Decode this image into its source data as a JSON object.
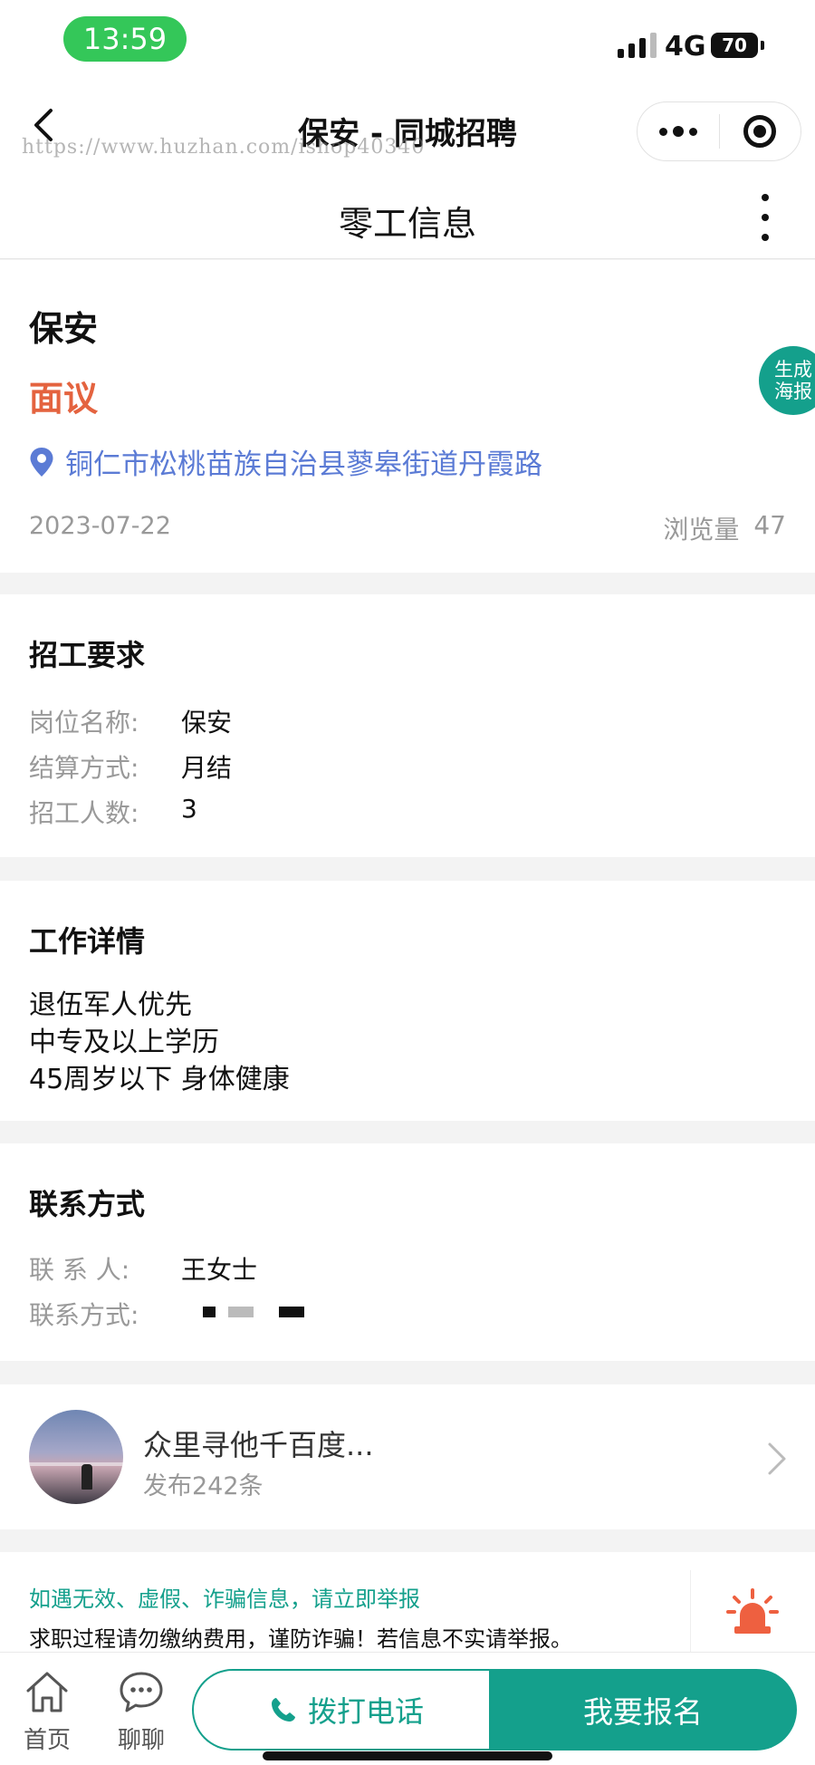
{
  "status_bar": {
    "time": "13:59",
    "network": "4G",
    "battery": "70"
  },
  "nav": {
    "title": "保安 - 同城招聘",
    "watermark": "https://www.huzhan.com/ishop40340"
  },
  "page": {
    "title": "零工信息"
  },
  "job": {
    "title": "保安",
    "salary": "面议",
    "poster_button": [
      "生成",
      "海报"
    ],
    "location": "铜仁市松桃苗族自治县蓼皋街道丹霞路",
    "date": "2023-07-22",
    "views_label": "浏览量",
    "views": "47"
  },
  "requirements": {
    "heading": "招工要求",
    "items": [
      {
        "k": "岗位名称:",
        "v": "保安"
      },
      {
        "k": "结算方式:",
        "v": "月结"
      },
      {
        "k": "招工人数:",
        "v": "3"
      }
    ]
  },
  "details": {
    "heading": "工作详情",
    "lines": [
      "退伍军人优先",
      "中专及以上学历",
      "45周岁以下 身体健康"
    ]
  },
  "contact": {
    "heading": "联系方式",
    "person_label": "联 系 人:",
    "person": "王女士",
    "phone_label": "联系方式:"
  },
  "poster": {
    "name": "众里寻他千百度...",
    "count": "发布242条"
  },
  "notice": {
    "line1": "如遇无效、虚假、诈骗信息，请立即举报",
    "line2": "求职过程请勿缴纳费用，谨防诈骗！若信息不实请举报。",
    "report": "举报"
  },
  "bottom_bar": {
    "home": "首页",
    "chat": "聊聊",
    "call": "拨打电话",
    "apply": "我要报名"
  },
  "colors": {
    "accent": "#14a08c",
    "salary": "#e4633f",
    "location": "#5b7bd5",
    "report": "#ee6040"
  }
}
